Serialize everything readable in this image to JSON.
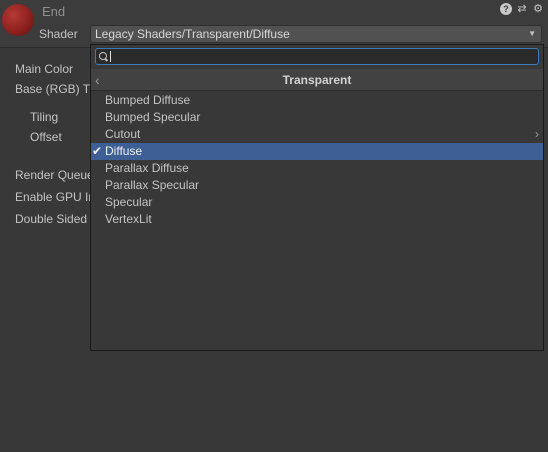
{
  "material": {
    "name": "End",
    "shader_label": "Shader",
    "shader_value": "Legacy Shaders/Transparent/Diffuse",
    "dropdown_arrow": "▼"
  },
  "header_icons": [
    {
      "name": "help-icon",
      "glyph": "?"
    },
    {
      "name": "preset-icon",
      "glyph": "⇄"
    },
    {
      "name": "settings-icon",
      "glyph": "⚙"
    }
  ],
  "properties": [
    {
      "label": "Main Color"
    },
    {
      "label": "Base (RGB) T"
    },
    {
      "label": "Tiling"
    },
    {
      "label": "Offset"
    },
    {
      "label": "Render Queue"
    },
    {
      "label": "Enable GPU In"
    },
    {
      "label": "Double Sided"
    }
  ],
  "popup": {
    "search_value": "",
    "category_title": "Transparent",
    "back_glyph": "‹",
    "items": [
      {
        "label": "Bumped Diffuse",
        "selected": false,
        "has_submenu": false
      },
      {
        "label": "Bumped Specular",
        "selected": false,
        "has_submenu": false
      },
      {
        "label": "Cutout",
        "selected": false,
        "has_submenu": true
      },
      {
        "label": "Diffuse",
        "selected": true,
        "has_submenu": false
      },
      {
        "label": "Parallax Diffuse",
        "selected": false,
        "has_submenu": false
      },
      {
        "label": "Parallax Specular",
        "selected": false,
        "has_submenu": false
      },
      {
        "label": "Specular",
        "selected": false,
        "has_submenu": false
      },
      {
        "label": "VertexLit",
        "selected": false,
        "has_submenu": false
      }
    ],
    "check_glyph": "✔",
    "submenu_glyph": "›"
  },
  "colors": {
    "background": "#383838",
    "selection": "#3e5f96",
    "search_focus": "#3a79bb",
    "material_preview": "#8a1f1c"
  }
}
